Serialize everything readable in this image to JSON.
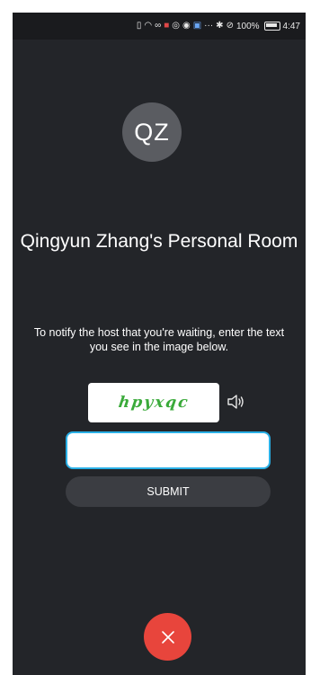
{
  "status_bar": {
    "icons": [
      "sim-icon",
      "wifi-icon",
      "link-icon",
      "notification-red-icon",
      "vpn-icon",
      "chrome-icon",
      "app-icon",
      "more-dots-icon",
      "bluetooth-icon",
      "mute-icon"
    ],
    "more": "···",
    "battery_percent": "100%",
    "time": "4:47"
  },
  "avatar": {
    "initials": "QZ",
    "color": "#5a5c61"
  },
  "room": {
    "title": "Qingyun Zhang's Personal Room"
  },
  "instructions": {
    "text": "To notify the host that you're waiting, enter the text you see in the image below."
  },
  "captcha": {
    "text": "hpyxqc",
    "text_color": "#3aaa3a",
    "audio_icon": "speaker-icon"
  },
  "input": {
    "value": "",
    "placeholder": "",
    "border_color": "#2ab0e6"
  },
  "submit": {
    "label": "SUBMIT"
  },
  "leave": {
    "icon": "close-icon",
    "color": "#e8453c"
  },
  "colors": {
    "background": "#232529",
    "status_bar": "#1a1b1e",
    "button": "#3b3d42"
  }
}
